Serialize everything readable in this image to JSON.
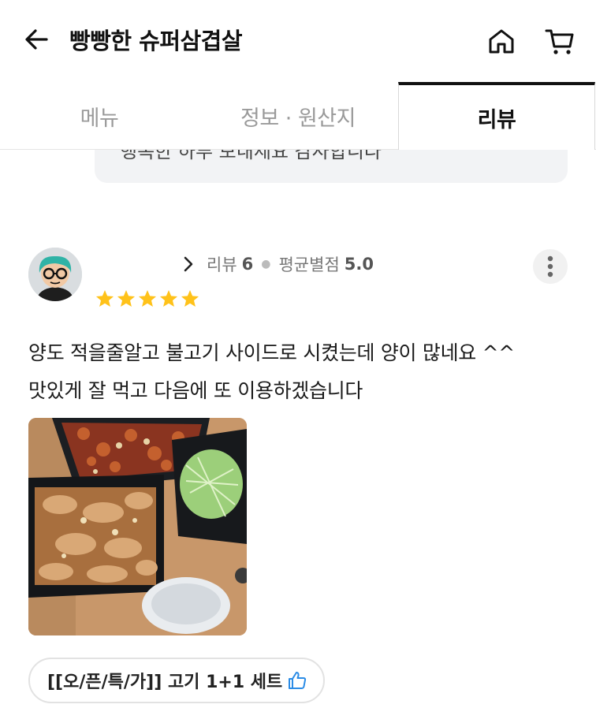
{
  "header": {
    "title": "빵빵한 슈퍼삼겹살",
    "icons": {
      "back": "arrow-left-icon",
      "home": "home-icon",
      "cart": "cart-icon"
    }
  },
  "tabs": {
    "menu": "메뉴",
    "info": "정보 · 원산지",
    "review": "리뷰",
    "active": "review"
  },
  "owner_reply": {
    "partial_text": "행복한 하루 보내세요 감사합니다"
  },
  "review": {
    "reviews_label": "리뷰",
    "reviews_count": "6",
    "avg_label": "평균별점",
    "avg_rating": "5.0",
    "stars": 5,
    "line1": "양도 적을줄알고 불고기 사이드로 시켰는데 양이 많네요 ^^",
    "line2": "맛있게 잘 먹고 다음에 또 이용하겠습니다",
    "menu_tag": "[[오/픈/특/가]] 고기 1+1 세트",
    "icons": {
      "more": "more-vertical-icon",
      "thumb": "thumbs-up-icon",
      "chevron": "chevron-right-icon"
    }
  },
  "colors": {
    "star": "#FFC21A",
    "active_tab": "#111111",
    "thumb": "#2B8CE6"
  }
}
